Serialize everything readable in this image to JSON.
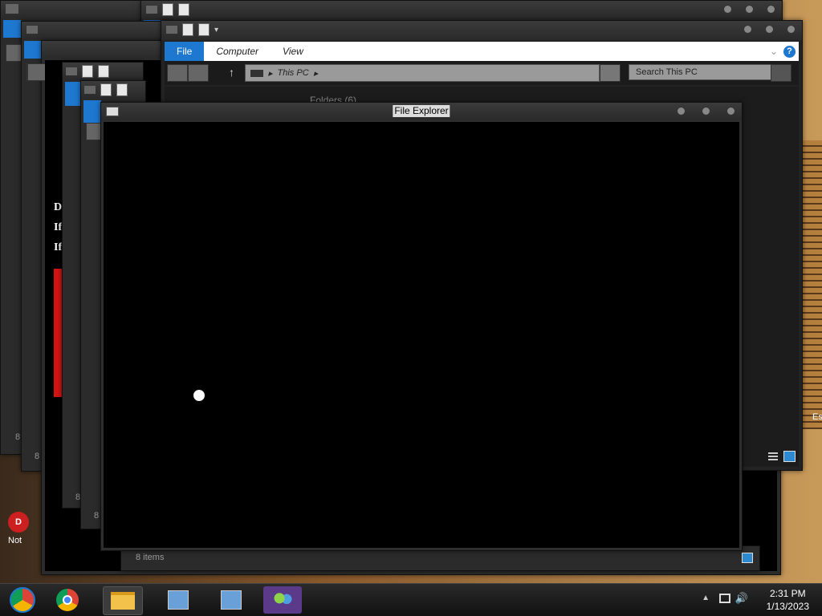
{
  "explorer": {
    "tabs": [
      {
        "label": "File"
      },
      {
        "label": "Computer"
      },
      {
        "label": "View"
      }
    ],
    "path": "This PC",
    "search_placeholder": "Search This PC",
    "folders_header": "Folders (6)"
  },
  "dialog": {
    "title": "File Explorer"
  },
  "status": {
    "items_count": "8 items",
    "short_count": "8"
  },
  "taskbar": {
    "apps": [
      {
        "name": "chrome-alt-icon"
      },
      {
        "name": "chrome-icon"
      },
      {
        "name": "file-explorer-icon"
      },
      {
        "name": "network-setup-icon-1"
      },
      {
        "name": "network-setup-icon-2"
      },
      {
        "name": "people-icon"
      }
    ],
    "time": "2:31 PM",
    "date": "1/13/2023"
  },
  "desktop": {
    "left_label": "Not",
    "side_text_1": "D",
    "side_text_2": "If",
    "side_text_3": "If",
    "right_edge_text": "Es"
  },
  "colors": {
    "accent": "#1e78d0",
    "window": "#2b2b2b",
    "content": "#000000"
  }
}
